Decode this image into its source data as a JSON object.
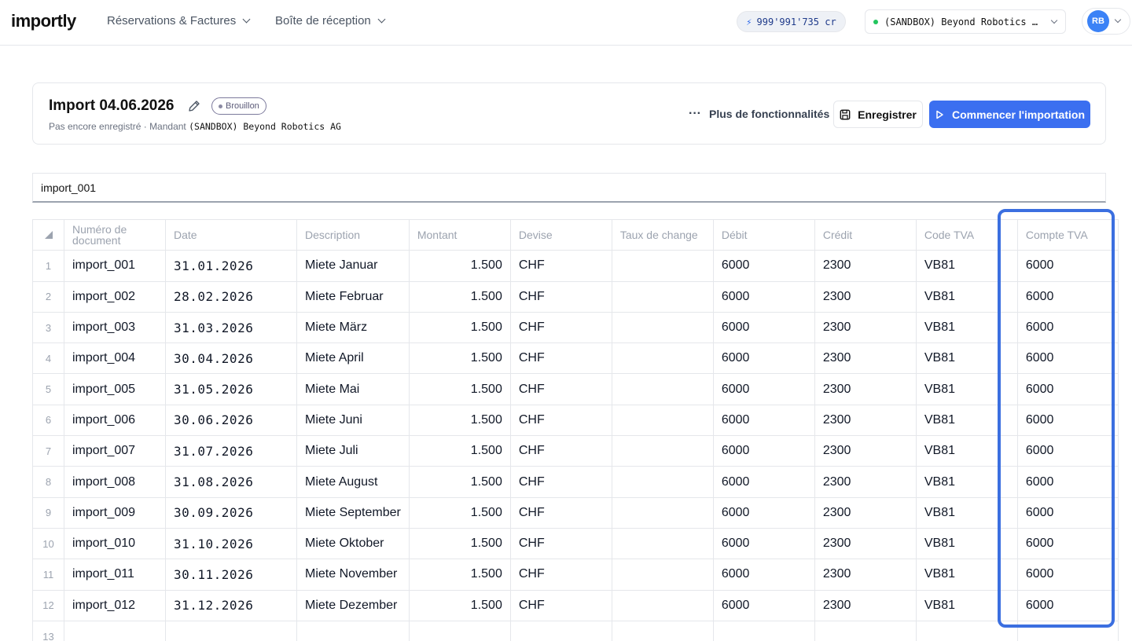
{
  "app": {
    "logo": "importly",
    "nav": [
      {
        "label": "Réservations & Factures"
      },
      {
        "label": "Boîte de réception"
      }
    ],
    "credits": "999'991'735 cr",
    "tenant": "(SANDBOX) Beyond Robotics …",
    "avatar": "RB"
  },
  "header": {
    "title": "Import 04.06.2026",
    "status": "Brouillon",
    "subtitle_prefix": "Pas encore enregistré · Mandant ",
    "subtitle_tenant": "(SANDBOX) Beyond Robotics AG",
    "more_label": "Plus de fonctionnalités",
    "save_label": "Enregistrer",
    "start_label": "Commencer l'importation"
  },
  "import_name": {
    "value": "import_001"
  },
  "table": {
    "columns": [
      "Numéro de document",
      "Date",
      "Description",
      "Montant",
      "Devise",
      "Taux de change",
      "Débit",
      "Crédit",
      "Code TVA",
      "Compte TVA"
    ],
    "rows": [
      {
        "n": "1",
        "doc": "import_001",
        "date": "31.01.2026",
        "desc": "Miete Januar",
        "amount": "1.500",
        "currency": "CHF",
        "rate": "",
        "debit": "6000",
        "credit": "2300",
        "vat_code": "VB81",
        "vat_account": "6000"
      },
      {
        "n": "2",
        "doc": "import_002",
        "date": "28.02.2026",
        "desc": "Miete Februar",
        "amount": "1.500",
        "currency": "CHF",
        "rate": "",
        "debit": "6000",
        "credit": "2300",
        "vat_code": "VB81",
        "vat_account": "6000"
      },
      {
        "n": "3",
        "doc": "import_003",
        "date": "31.03.2026",
        "desc": "Miete März",
        "amount": "1.500",
        "currency": "CHF",
        "rate": "",
        "debit": "6000",
        "credit": "2300",
        "vat_code": "VB81",
        "vat_account": "6000"
      },
      {
        "n": "4",
        "doc": "import_004",
        "date": "30.04.2026",
        "desc": "Miete April",
        "amount": "1.500",
        "currency": "CHF",
        "rate": "",
        "debit": "6000",
        "credit": "2300",
        "vat_code": "VB81",
        "vat_account": "6000"
      },
      {
        "n": "5",
        "doc": "import_005",
        "date": "31.05.2026",
        "desc": "Miete Mai",
        "amount": "1.500",
        "currency": "CHF",
        "rate": "",
        "debit": "6000",
        "credit": "2300",
        "vat_code": "VB81",
        "vat_account": "6000"
      },
      {
        "n": "6",
        "doc": "import_006",
        "date": "30.06.2026",
        "desc": "Miete Juni",
        "amount": "1.500",
        "currency": "CHF",
        "rate": "",
        "debit": "6000",
        "credit": "2300",
        "vat_code": "VB81",
        "vat_account": "6000"
      },
      {
        "n": "7",
        "doc": "import_007",
        "date": "31.07.2026",
        "desc": "Miete Juli",
        "amount": "1.500",
        "currency": "CHF",
        "rate": "",
        "debit": "6000",
        "credit": "2300",
        "vat_code": "VB81",
        "vat_account": "6000"
      },
      {
        "n": "8",
        "doc": "import_008",
        "date": "31.08.2026",
        "desc": "Miete August",
        "amount": "1.500",
        "currency": "CHF",
        "rate": "",
        "debit": "6000",
        "credit": "2300",
        "vat_code": "VB81",
        "vat_account": "6000"
      },
      {
        "n": "9",
        "doc": "import_009",
        "date": "30.09.2026",
        "desc": "Miete September",
        "amount": "1.500",
        "currency": "CHF",
        "rate": "",
        "debit": "6000",
        "credit": "2300",
        "vat_code": "VB81",
        "vat_account": "6000"
      },
      {
        "n": "10",
        "doc": "import_010",
        "date": "31.10.2026",
        "desc": "Miete Oktober",
        "amount": "1.500",
        "currency": "CHF",
        "rate": "",
        "debit": "6000",
        "credit": "2300",
        "vat_code": "VB81",
        "vat_account": "6000"
      },
      {
        "n": "11",
        "doc": "import_011",
        "date": "30.11.2026",
        "desc": "Miete November",
        "amount": "1.500",
        "currency": "CHF",
        "rate": "",
        "debit": "6000",
        "credit": "2300",
        "vat_code": "VB81",
        "vat_account": "6000"
      },
      {
        "n": "12",
        "doc": "import_012",
        "date": "31.12.2026",
        "desc": "Miete Dezember",
        "amount": "1.500",
        "currency": "CHF",
        "rate": "",
        "debit": "6000",
        "credit": "2300",
        "vat_code": "VB81",
        "vat_account": "6000"
      },
      {
        "n": "13",
        "doc": "",
        "date": "",
        "desc": "",
        "amount": "",
        "currency": "",
        "rate": "",
        "debit": "",
        "credit": "",
        "vat_code": "",
        "vat_account": ""
      }
    ]
  },
  "colors": {
    "accent": "#3b6ff0",
    "highlight": "#3b6fe0",
    "status_dot": "#22c55e"
  }
}
